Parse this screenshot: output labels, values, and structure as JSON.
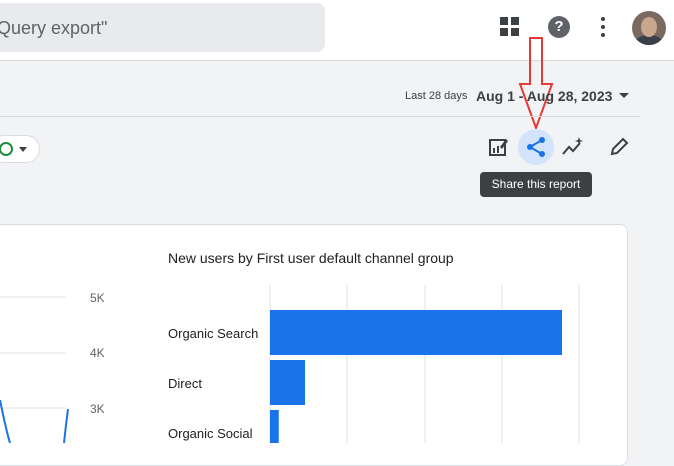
{
  "search": {
    "text": "Query export\""
  },
  "header": {
    "help_glyph": "?"
  },
  "date": {
    "badge": "Last 28 days",
    "range": "Aug 1 - Aug 28, 2023"
  },
  "toolbar": {
    "tooltip": "Share this report"
  },
  "card": {
    "title": "New users by First user default channel group"
  },
  "chart_data": [
    {
      "type": "line",
      "title": "",
      "yticks": [
        "5K",
        "4K",
        "3K"
      ],
      "series": [
        {
          "values": []
        }
      ],
      "note_partial": "left chart mostly cropped"
    },
    {
      "type": "bar",
      "title": "New users by First user default channel group",
      "categories": [
        "Organic Search",
        "Direct",
        "Organic Social"
      ],
      "values": [
        100,
        12,
        3
      ],
      "value_scale": "relative (axis values not shown)"
    }
  ]
}
